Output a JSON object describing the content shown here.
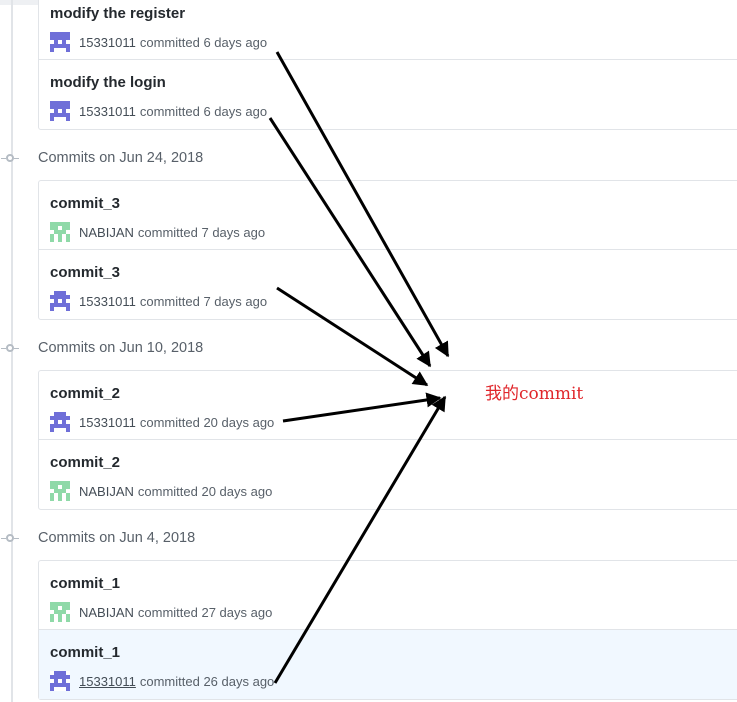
{
  "groups": [
    {
      "title": "",
      "commits": [
        {
          "message": "modify the register",
          "author": "15331011",
          "committed": "committed 6 days ago",
          "avatar": "purple-identicon",
          "highlight": false
        },
        {
          "message": "modify the login",
          "author": "15331011",
          "committed": "committed 6 days ago",
          "avatar": "purple-identicon",
          "highlight": false
        }
      ]
    },
    {
      "title": "Commits on Jun 24, 2018",
      "commits": [
        {
          "message": "commit_3",
          "author": "NABIJAN",
          "committed": "committed 7 days ago",
          "avatar": "green-identicon",
          "highlight": false
        },
        {
          "message": "commit_3",
          "author": "15331011",
          "committed": "committed 7 days ago",
          "avatar": "purple-identicon",
          "highlight": false
        }
      ]
    },
    {
      "title": "Commits on Jun 10, 2018",
      "commits": [
        {
          "message": "commit_2",
          "author": "15331011",
          "committed": "committed 20 days ago",
          "avatar": "purple-identicon",
          "highlight": false
        },
        {
          "message": "commit_2",
          "author": "NABIJAN",
          "committed": "committed 20 days ago",
          "avatar": "green-identicon",
          "highlight": false
        }
      ]
    },
    {
      "title": "Commits on Jun 4, 2018",
      "commits": [
        {
          "message": "commit_1",
          "author": "NABIJAN",
          "committed": "committed 27 days ago",
          "avatar": "green-identicon",
          "highlight": false
        },
        {
          "message": "commit_1",
          "author": "15331011",
          "committed": "committed 26 days ago",
          "avatar": "purple-identicon",
          "highlight": true
        }
      ]
    }
  ],
  "annotation": {
    "text": "我的commit",
    "color": "#e0262b"
  },
  "colors": {
    "purple_avatar": "#6f6fd8",
    "green_avatar": "#8fd9a8",
    "arrow": "#000000"
  }
}
